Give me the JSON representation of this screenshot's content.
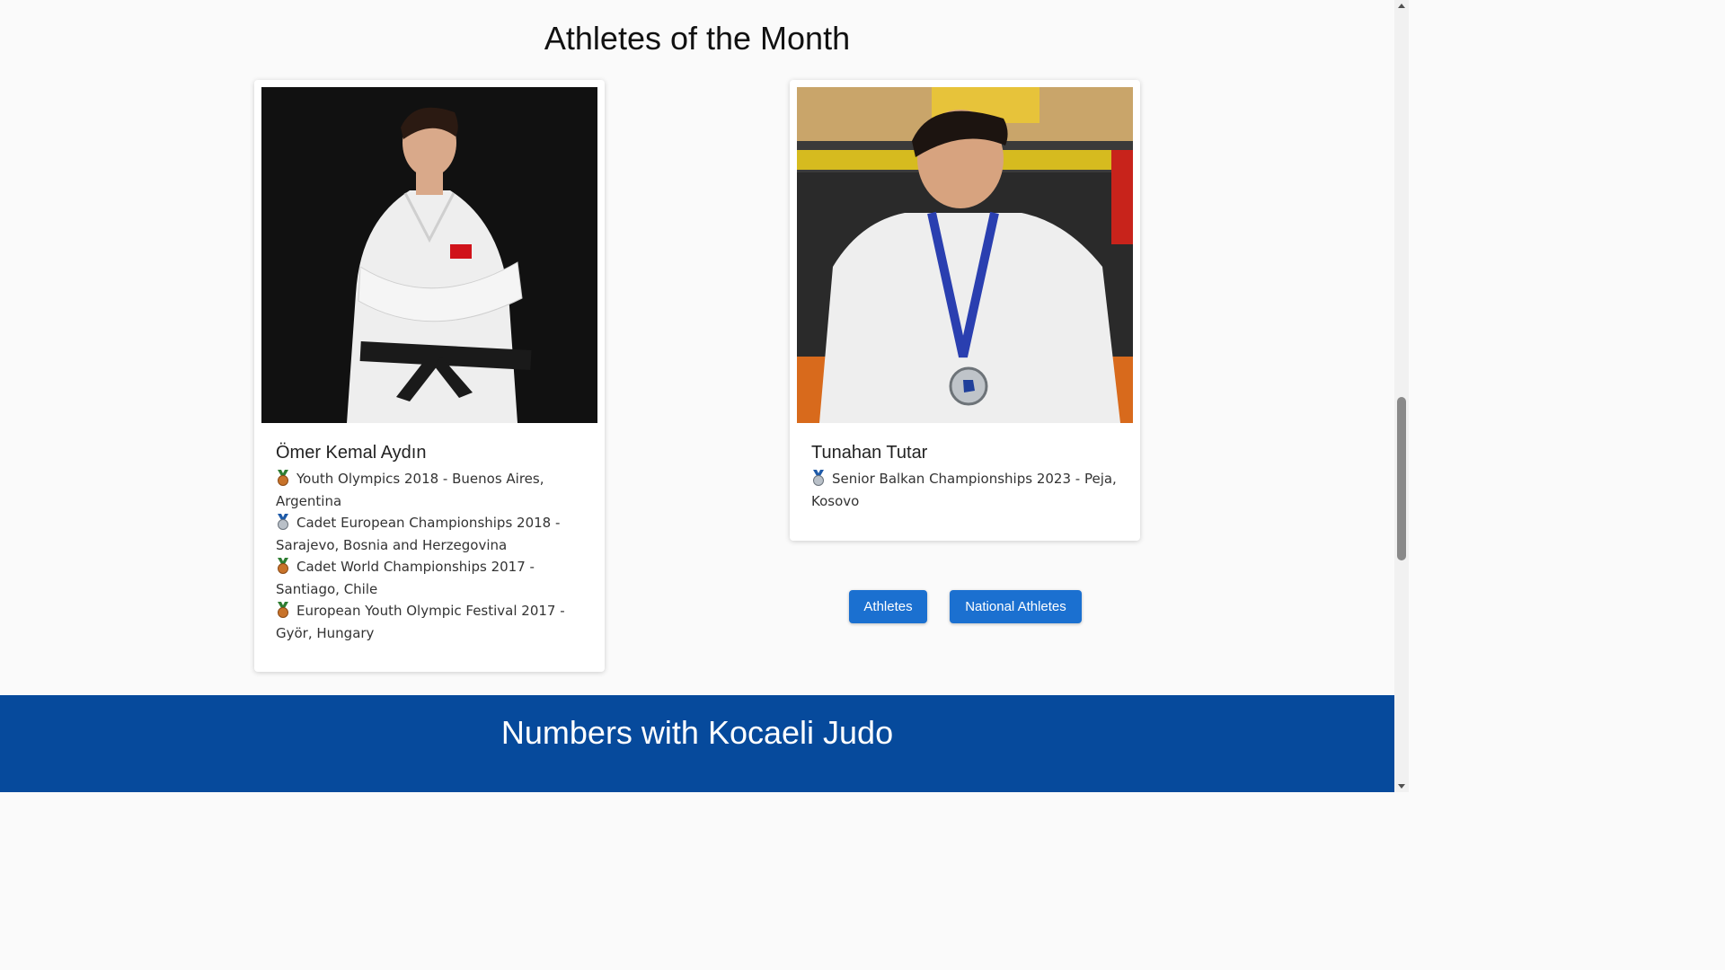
{
  "section": {
    "title": "Athletes of the Month"
  },
  "athletes": [
    {
      "name": "Ömer Kemal Aydın",
      "photo_alt": "Ömer Kemal Aydın",
      "achievements": [
        {
          "medal": "bronze-medal-icon",
          "text": "Youth Olympics 2018 - Buenos Aires, Argentina"
        },
        {
          "medal": "silver-medal-icon",
          "text": "Cadet European Championships 2018 - Sarajevo, Bosnia and Herzegovina"
        },
        {
          "medal": "bronze-medal-icon",
          "text": "Cadet World Championships 2017 - Santiago, Chile"
        },
        {
          "medal": "bronze-medal-icon",
          "text": "European Youth Olympic Festival 2017 - Györ, Hungary"
        }
      ]
    },
    {
      "name": "Tunahan Tutar",
      "photo_alt": "Tunahan Tutar",
      "achievements": [
        {
          "medal": "silver-medal-icon",
          "text": "Senior Balkan Championships 2023 - Peja, Kosovo"
        }
      ]
    }
  ],
  "buttons": {
    "athletes": "Athletes",
    "national_athletes": "National Athletes"
  },
  "numbers": {
    "title": "Numbers with Kocaeli Judo"
  },
  "colors": {
    "primary": "#1b70d0",
    "band": "#064a9c",
    "bronze": "#c8732a",
    "silver": "#9aa3ad",
    "ribbon": "#2e7d32"
  }
}
